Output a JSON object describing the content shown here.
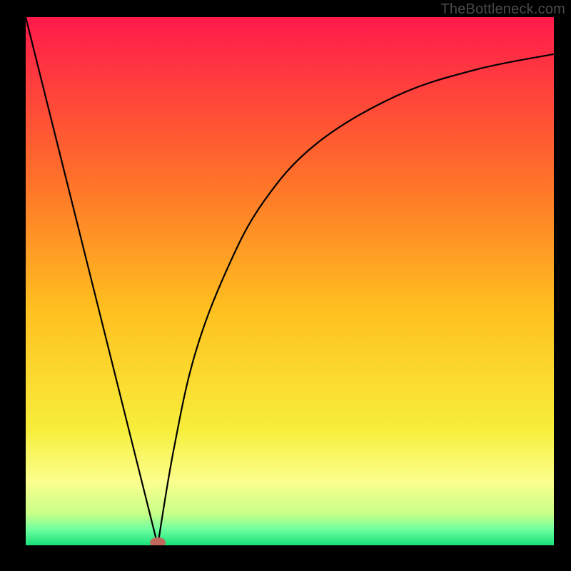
{
  "watermark": "TheBottleneck.com",
  "chart_data": {
    "type": "line",
    "title": "",
    "xlabel": "",
    "ylabel": "",
    "xlim": [
      0,
      1
    ],
    "ylim": [
      0,
      1
    ],
    "series": [
      {
        "name": "left-branch",
        "x": [
          0.0,
          0.05,
          0.1,
          0.15,
          0.2,
          0.225,
          0.25
        ],
        "values": [
          1.0,
          0.8,
          0.6,
          0.4,
          0.2,
          0.1,
          0.0
        ]
      },
      {
        "name": "right-branch",
        "x": [
          0.25,
          0.28,
          0.32,
          0.38,
          0.45,
          0.55,
          0.7,
          0.85,
          1.0
        ],
        "values": [
          0.0,
          0.18,
          0.36,
          0.52,
          0.65,
          0.76,
          0.85,
          0.9,
          0.93
        ]
      }
    ],
    "marker": {
      "x": 0.25,
      "y": 0.0,
      "color": "#c1695c"
    },
    "background_gradient": {
      "type": "vertical",
      "stops": [
        {
          "pos": 0.0,
          "color": "#ff1a4b"
        },
        {
          "pos": 0.3,
          "color": "#ff6f2a"
        },
        {
          "pos": 0.55,
          "color": "#ffbf1f"
        },
        {
          "pos": 0.78,
          "color": "#f7ee3a"
        },
        {
          "pos": 0.88,
          "color": "#fbff8e"
        },
        {
          "pos": 0.94,
          "color": "#c9ff88"
        },
        {
          "pos": 0.97,
          "color": "#6dff9e"
        },
        {
          "pos": 1.0,
          "color": "#18e07b"
        }
      ]
    }
  }
}
